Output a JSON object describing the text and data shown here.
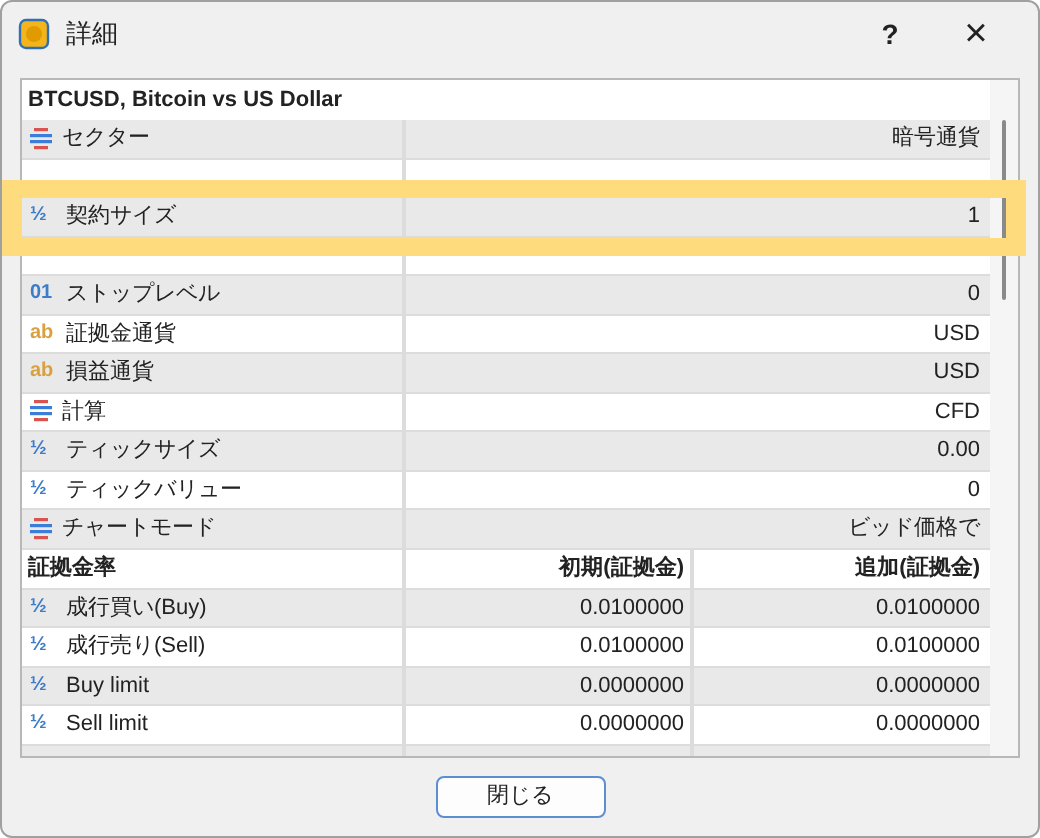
{
  "window": {
    "title": "詳細",
    "help": "?",
    "close": "×"
  },
  "symbol_title": "BTCUSD, Bitcoin vs US Dollar",
  "properties": [
    {
      "kind": "list",
      "label": "セクター",
      "value": "暗号通貨"
    },
    {
      "kind": "fraction",
      "icon": "½",
      "label": "契約サイズ",
      "value": "1",
      "highlighted": true
    },
    {
      "kind": "number",
      "icon": "01",
      "label": "ストップレベル",
      "value": "0"
    },
    {
      "kind": "text",
      "icon": "ab",
      "label": "証拠金通貨",
      "value": "USD"
    },
    {
      "kind": "text",
      "icon": "ab",
      "label": "損益通貨",
      "value": "USD"
    },
    {
      "kind": "list",
      "label": "計算",
      "value": "CFD"
    },
    {
      "kind": "fraction",
      "icon": "½",
      "label": "ティックサイズ",
      "value": "0.00"
    },
    {
      "kind": "fraction",
      "icon": "½",
      "label": "ティックバリュー",
      "value": "0"
    },
    {
      "kind": "list",
      "label": "チャートモード",
      "value": "ビッド価格で"
    }
  ],
  "margin_table": {
    "columns": [
      "証拠金率",
      "初期(証拠金)",
      "追加(証拠金)"
    ],
    "rows": [
      {
        "icon": "½",
        "label": "成行買い(Buy)",
        "initial": "0.0100000",
        "maintenance": "0.0100000"
      },
      {
        "icon": "½",
        "label": "成行売り(Sell)",
        "initial": "0.0100000",
        "maintenance": "0.0100000"
      },
      {
        "icon": "½",
        "label": "Buy limit",
        "initial": "0.0000000",
        "maintenance": "0.0000000"
      },
      {
        "icon": "½",
        "label": "Sell limit",
        "initial": "0.0000000",
        "maintenance": "0.0000000"
      }
    ]
  },
  "close_button": "閉じる"
}
